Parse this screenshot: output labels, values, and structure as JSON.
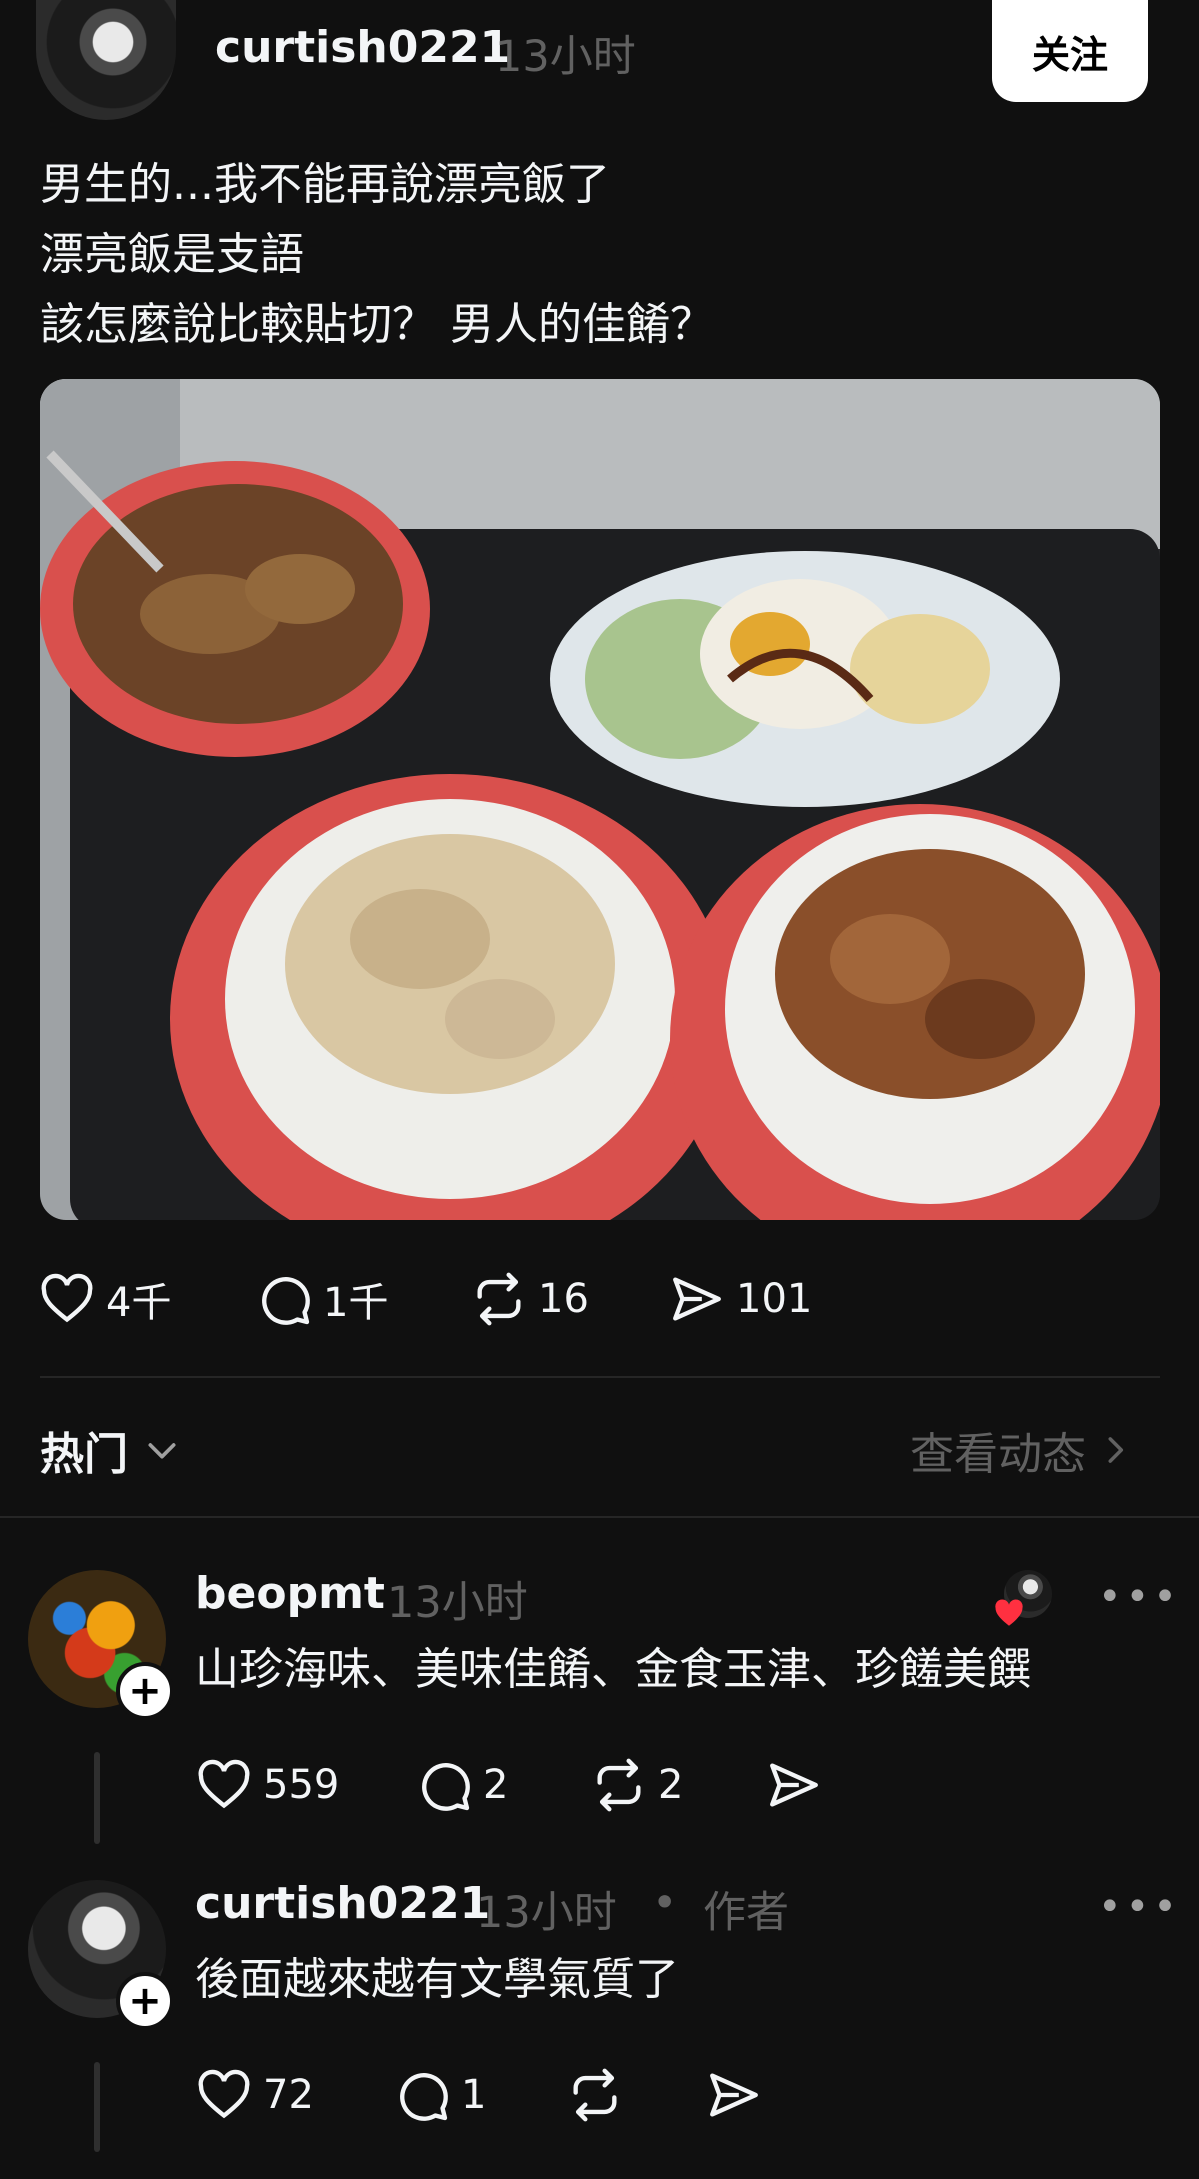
{
  "post": {
    "username": "curtish0221",
    "time": "13小时",
    "follow_label": "关注",
    "text_lines": [
      "男生的...我不能再說漂亮飯了",
      "漂亮飯是支語",
      "該怎麼說比較貼切？ 男人的佳餚？"
    ],
    "image_alt": "三碗飯與湯、荷包蛋青菜的餐盤",
    "actions": {
      "likes": "4千",
      "replies": "1千",
      "reposts": "16",
      "shares": "101"
    }
  },
  "sort": {
    "label": "热门",
    "view_activity": "查看动态"
  },
  "comments": [
    {
      "username": "beopmt",
      "time": "13小时",
      "text": "山珍海味、美味佳餚、金食玉津、珍饈美饌",
      "likes": "559",
      "replies": "2",
      "reposts": "2"
    },
    {
      "username": "curtish0221",
      "time": "13小时",
      "author_tag": "作者",
      "dot": "•",
      "text": "後面越來越有文學氣質了",
      "likes": "72",
      "replies": "1"
    }
  ],
  "colors": {
    "background": "#101010",
    "text": "#f3f5f7",
    "muted": "#616161",
    "heart": "#ff3040"
  }
}
